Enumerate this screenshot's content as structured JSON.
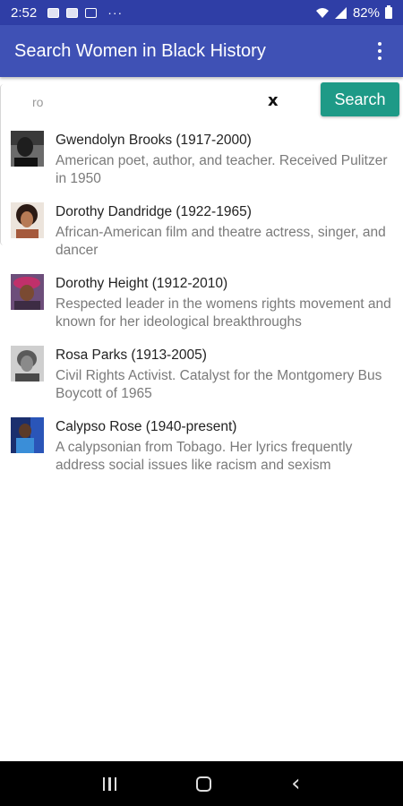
{
  "status_bar": {
    "time": "2:52",
    "battery": "82%",
    "more": "···"
  },
  "app_bar": {
    "title": "Search Women in Black History"
  },
  "search": {
    "value": "ro",
    "clear_label": "x",
    "button_label": "Search"
  },
  "results": [
    {
      "name": "Gwendolyn Brooks (1917-2000)",
      "description": "American poet, author, and teacher.  Received Pulitzer in 1950"
    },
    {
      "name": "Dorothy Dandridge (1922-1965)",
      "description": "African-American film and theatre actress, singer, and dancer"
    },
    {
      "name": "Dorothy Height (1912-2010)",
      "description": "Respected leader in the womens rights movement and known for her ideological breakthroughs"
    },
    {
      "name": "Rosa Parks (1913-2005)",
      "description": "Civil Rights Activist.  Catalyst for the Montgomery Bus Boycott of 1965"
    },
    {
      "name": "Calypso Rose (1940-present)",
      "description": "A calypsonian from Tobago.  Her lyrics frequently address social issues like racism and sexism"
    }
  ],
  "colors": {
    "status_bar": "#2f3ea6",
    "app_bar": "#3f51b5",
    "search_button": "#1e9a87"
  }
}
